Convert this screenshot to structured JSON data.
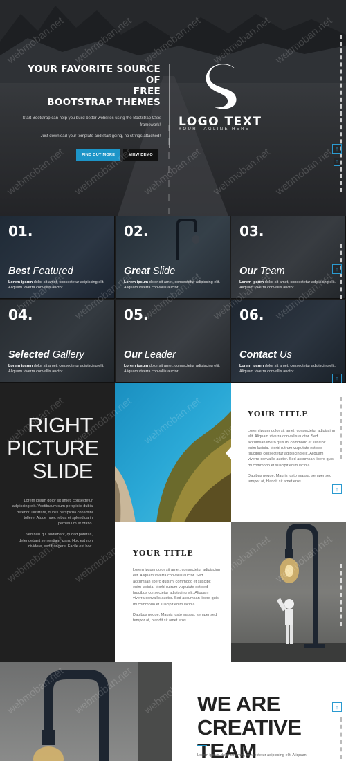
{
  "hero": {
    "title": "YOUR FAVORITE SOURCE OF\nFREE\nBOOTSTRAP THEMES",
    "desc1": "Start Bootstrap can help you build better websites using the Bootstrap CSS framework!",
    "desc2": "Just download your template and start going, no strings attached!",
    "btn_primary": "FIND OUT MORE",
    "btn_secondary": "VIEW DEMO",
    "logo_text": "LOGO TEXT",
    "tagline": "YOUR TAGLINE HERE"
  },
  "features": [
    {
      "num": "01.",
      "bold": "Best",
      "light": "Featured",
      "lead": "Lorem ipsum",
      "desc": "dolor sit amet, consectetur adipiscing elit. Aliquam viverra convallis auctor."
    },
    {
      "num": "02.",
      "bold": "Great",
      "light": "Slide",
      "lead": "Lorem ipsum",
      "desc": "dolor sit amet, consectetur adipiscing elit. Aliquam viverra convallis auctor."
    },
    {
      "num": "03.",
      "bold": "Our",
      "light": "Team",
      "lead": "Lorem ipsum",
      "desc": "dolor sit amet, consectetur adipiscing elit. Aliquam viverra convallis auctor."
    },
    {
      "num": "04.",
      "bold": "Selected",
      "light": "Gallery",
      "lead": "Lorem ipsum",
      "desc": "dolor sit amet, consectetur adipiscing elit. Aliquam viverra convallis auctor."
    },
    {
      "num": "05.",
      "bold": "Our",
      "light": "Leader",
      "lead": "Lorem ipsum",
      "desc": "dolor sit amet, consectetur adipiscing elit. Aliquam viverra convallis auctor."
    },
    {
      "num": "06.",
      "bold": "Contact",
      "light": "Us",
      "lead": "Lorem ipsum",
      "desc": "dolor sit amet, consectetur adipiscing elit. Aliquam viverra convallis auctor."
    }
  ],
  "slide": {
    "heading": "RIGHT\nPICTURE\nSLIDE",
    "para1": "Lorem ipsum dolor sit amet, consectetur adipiscing elit. Vestibulum cum perspiciis dubia defendi: illustrare, dubiis perspicua conamini tollere. Atque haec rebus et splendida in perpetuum et oratio.",
    "para2": "Sed nulli qui audiebant, quoad poteras, defendebant sententiam tuam. Hoc est non dividere, sed frangere. Facile est hoc."
  },
  "card1": {
    "title": "YOUR TITLE",
    "body": "Lorem ipsum dolor sit amet, consectetur adipiscing elit. Aliquam viverra convallis auctor. Sed accumsan libero quis mi commodo et suscipit enim lacinia. Morbi rutrum vulputate est sed faucibus consectetur adipiscing elit. Aliquam viverra convallis auctor. Sed accumsan libero quis mi commodo et suscipit enim lacinia.",
    "foot": "Dapibus neque. Mauris justo massa, semper sed tempor at, blandit sit amet eros."
  },
  "card2": {
    "title": "YOUR TITLE",
    "body": "Lorem ipsum dolor sit amet, consectetur adipiscing elit. Aliquam viverra convallis auctor. Sed accumsan libero quis mi commodo et suscipit enim lacinia. Morbi rutrum vulputate est sed faucibus consectetur adipiscing elit. Aliquam viverra convallis auctor. Sed accumsan libero quis mi commodo et suscipit enim lacinia.",
    "foot": "Dapibus neque. Mauris justo massa, semper sed tempor at, blandit sit amet eros."
  },
  "team": {
    "heading": "WE ARE\nCREATIVE TEAM",
    "text": "Lorem ipsum dolor sit amet, consectetur adipiscing elit. Aliquam"
  },
  "watermark": "webmoban.net",
  "colors": {
    "accent": "#1d95c8",
    "dark": "#202020",
    "card": "#ffffff"
  }
}
